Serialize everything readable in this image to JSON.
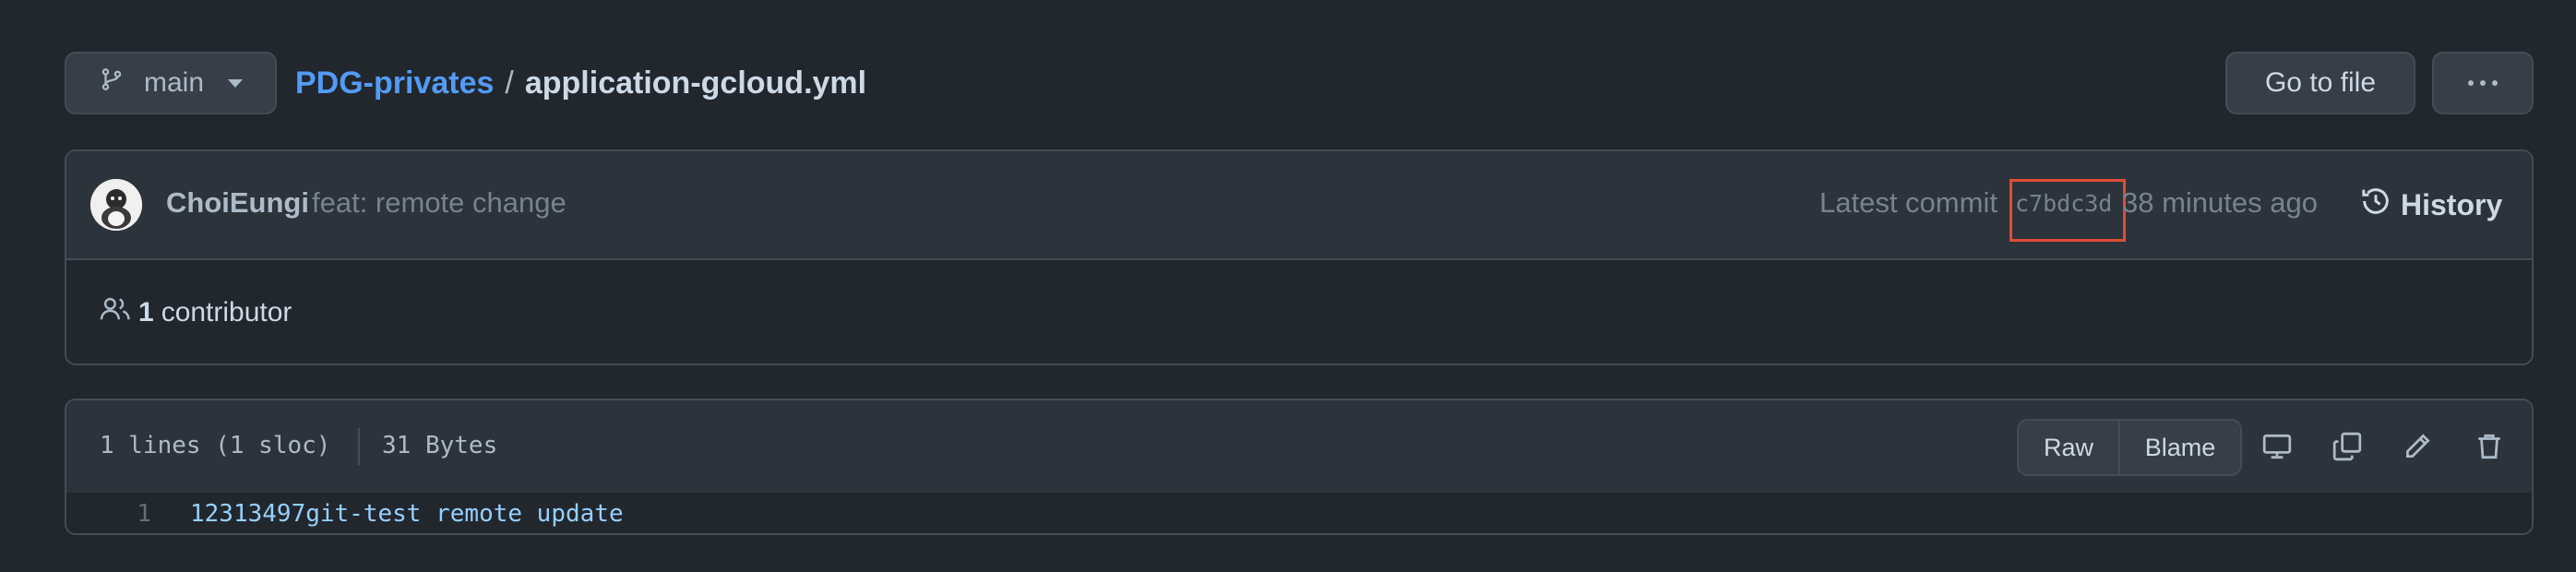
{
  "header": {
    "branch_label": "main",
    "repo_name": "PDG-privates",
    "separator": "/",
    "file_name": "application-gcloud.yml",
    "goto_label": "Go to file"
  },
  "commit": {
    "author": "ChoiEungi",
    "message": "feat: remote change",
    "latest_label": "Latest commit",
    "sha": "c7bdc3d",
    "time_ago": "38 minutes ago",
    "history_label": "History",
    "highlight_color": "#e04c36"
  },
  "contributors": {
    "count": "1",
    "label": "contributor"
  },
  "file": {
    "lines_info": "1 lines (1 sloc)",
    "size": "31 Bytes",
    "raw_label": "Raw",
    "blame_label": "Blame",
    "icons": [
      "desktop-icon",
      "copy-icon",
      "pencil-icon",
      "trash-icon"
    ],
    "code_lines": [
      {
        "number": "1",
        "text": "12313497git-test remote update"
      }
    ]
  },
  "colors": {
    "background": "#22272e",
    "panel": "#2d333b",
    "border": "#444c56",
    "link": "#539bf5"
  }
}
